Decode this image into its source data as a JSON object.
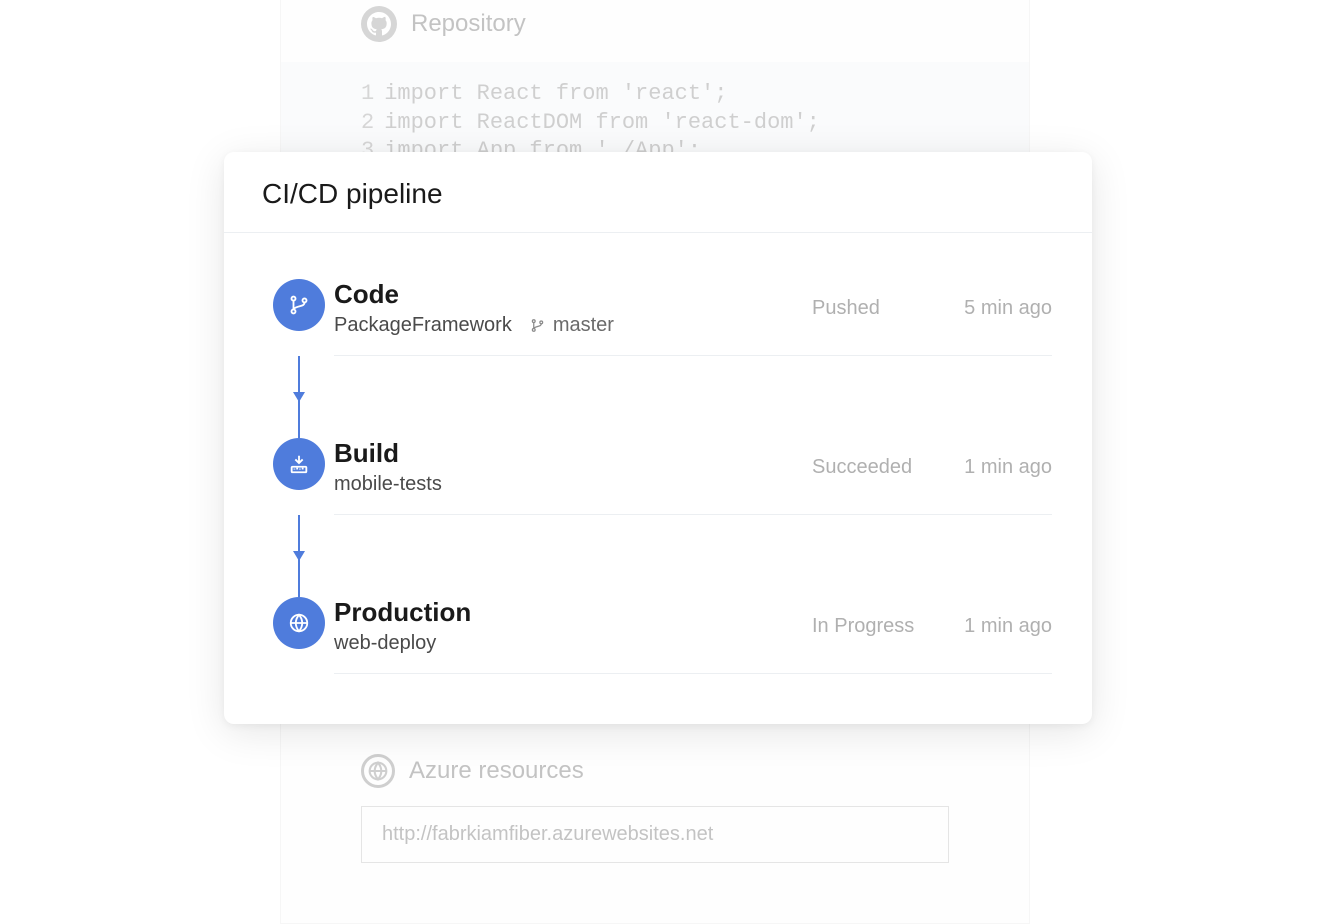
{
  "background": {
    "repo_label": "Repository",
    "code_lines": [
      {
        "n": "1",
        "t": "import React from 'react';"
      },
      {
        "n": "2",
        "t": "import ReactDOM from 'react-dom';"
      },
      {
        "n": "3",
        "t": "import App from './App';"
      }
    ],
    "azure_label": "Azure resources",
    "url": "http://fabrkiamfiber.azurewebsites.net"
  },
  "card": {
    "title": "CI/CD pipeline"
  },
  "stages": [
    {
      "title": "Code",
      "subtitle": "PackageFramework",
      "branch": "master",
      "status": "Pushed",
      "time": "5 min ago"
    },
    {
      "title": "Build",
      "subtitle": "mobile-tests",
      "branch": "",
      "status": "Succeeded",
      "time": "1 min ago"
    },
    {
      "title": "Production",
      "subtitle": "web-deploy",
      "branch": "",
      "status": "In Progress",
      "time": "1 min ago"
    }
  ]
}
